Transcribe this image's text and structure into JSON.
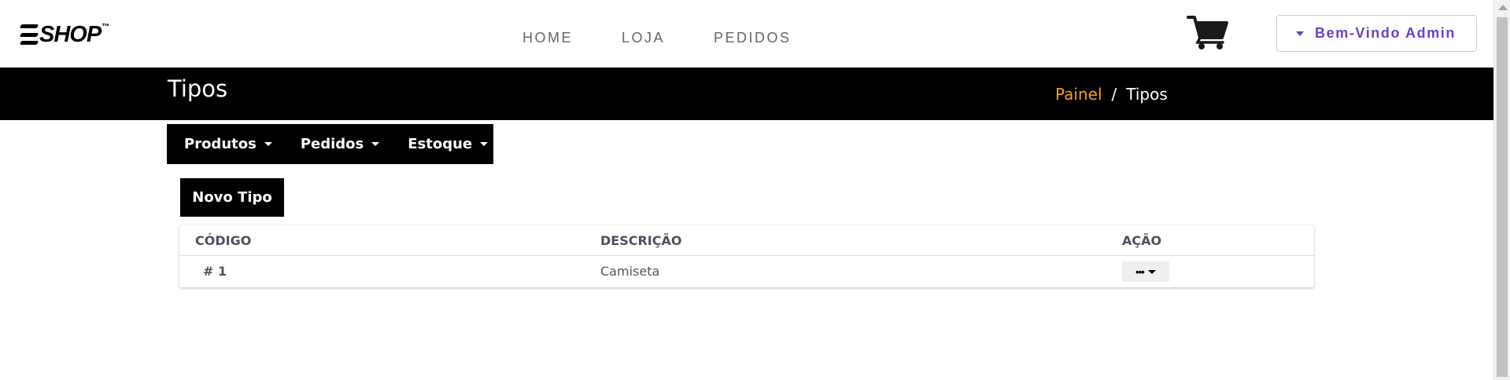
{
  "header": {
    "logo_text": "SHOP",
    "logo_tm": "™",
    "nav": [
      {
        "label": "HOME"
      },
      {
        "label": "LOJA"
      },
      {
        "label": "PEDIDOS"
      }
    ],
    "cart_icon": "shopping-cart-icon",
    "welcome_label": "Bem-Vindo Admin"
  },
  "banner": {
    "title": "Tipos",
    "breadcrumb": {
      "link": "Painel",
      "separator": "/",
      "current": "Tipos"
    }
  },
  "submenu": [
    {
      "label": "Produtos"
    },
    {
      "label": "Pedidos"
    },
    {
      "label": "Estoque"
    }
  ],
  "new_button_label": "Novo Tipo",
  "table": {
    "columns": [
      "CÓDIGO",
      "DESCRIÇÃO",
      "AÇÃO"
    ],
    "rows": [
      {
        "code": "# 1",
        "description": "Camiseta",
        "action_label": "•••"
      }
    ]
  },
  "colors": {
    "accent_purple": "#6a3fc4",
    "breadcrumb_orange": "#f5a016",
    "banner_bg": "#000000"
  }
}
